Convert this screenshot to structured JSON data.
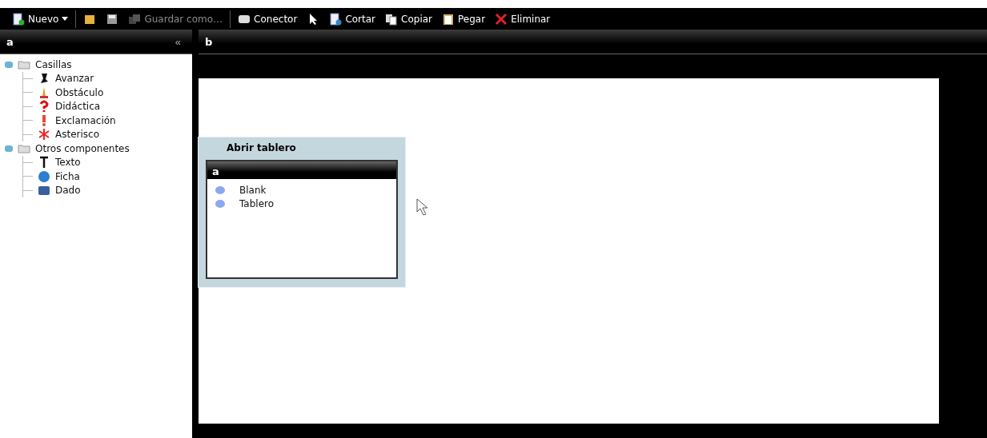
{
  "toolbar": [
    {
      "kind": "button",
      "label": "Nuevo",
      "dropdown": true,
      "disabled": false
    },
    {
      "kind": "separator"
    },
    {
      "kind": "icon",
      "disabled": false
    },
    {
      "kind": "icon",
      "disabled": false
    },
    {
      "kind": "button",
      "label": "Guardar como…",
      "dropdown": false,
      "disabled": true
    },
    {
      "kind": "separator"
    },
    {
      "kind": "button",
      "label": "Conector",
      "dropdown": false,
      "disabled": false
    },
    {
      "kind": "icon",
      "disabled": false
    },
    {
      "kind": "button",
      "label": "Cortar",
      "dropdown": false,
      "disabled": false
    },
    {
      "kind": "button",
      "label": "Copiar",
      "dropdown": false,
      "disabled": false
    },
    {
      "kind": "button",
      "label": "Pegar",
      "dropdown": false,
      "disabled": false
    },
    {
      "kind": "button",
      "label": "Eliminar",
      "dropdown": false,
      "disabled": false
    }
  ],
  "left_panel": {
    "title": "a",
    "collapse": "«",
    "tree": [
      {
        "label": "Casillas",
        "expanded": true,
        "children": [
          {
            "label": "Avanzar"
          },
          {
            "label": "Obstáculo"
          },
          {
            "label": "Didáctica"
          },
          {
            "label": "Exclamación"
          },
          {
            "label": "Asterisco"
          }
        ]
      },
      {
        "label": "Otros componentes",
        "expanded": true,
        "children": [
          {
            "label": "Texto"
          },
          {
            "label": "Ficha"
          },
          {
            "label": "Dado"
          }
        ]
      }
    ]
  },
  "main_panel": {
    "title": "b"
  },
  "dialog": {
    "title": "Abrir tablero",
    "panel_title": "a",
    "items": [
      "Blank",
      "Tablero"
    ]
  }
}
